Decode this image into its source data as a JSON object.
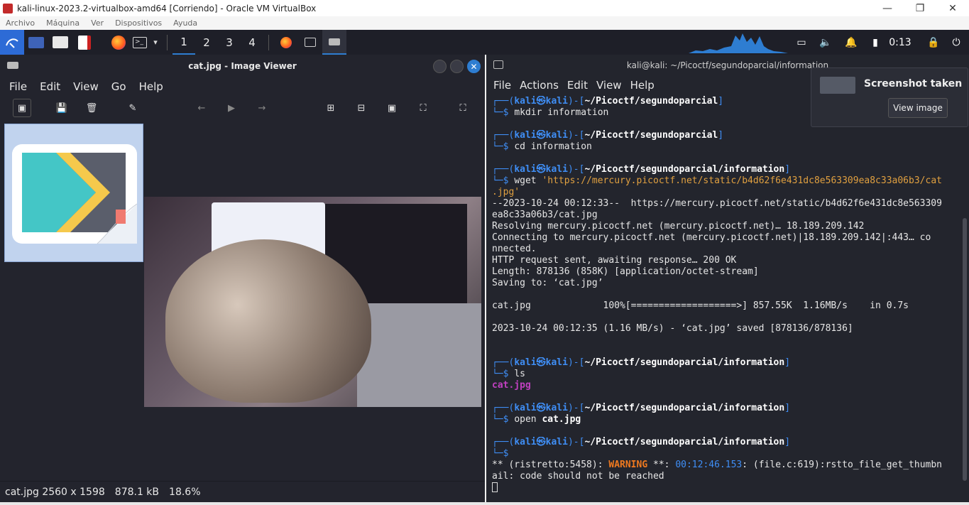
{
  "vbox": {
    "title": "kali-linux-2023.2-virtualbox-amd64 [Corriendo] - Oracle VM VirtualBox",
    "menu": [
      "Archivo",
      "Máquina",
      "Ver",
      "Dispositivos",
      "Ayuda"
    ],
    "controls": {
      "minimize": "—",
      "restore": "❐",
      "close": "✕"
    }
  },
  "panel": {
    "workspaces": [
      "1",
      "2",
      "3",
      "4"
    ],
    "clock": "0:13",
    "icons": [
      "kali-menu-icon",
      "desktop-icon",
      "files-icon",
      "text-editor-icon",
      "firefox-icon",
      "terminal-icon",
      "chevron-down-icon",
      "firefox-task-icon",
      "terminal-task-icon",
      "viewer-task-icon",
      "display-icon",
      "volume-icon",
      "bell-icon",
      "battery-icon",
      "lock-icon",
      "logout-icon"
    ]
  },
  "viewer": {
    "title": "cat.jpg - Image Viewer",
    "menu": [
      "File",
      "Edit",
      "View",
      "Go",
      "Help"
    ],
    "status": {
      "name_size": "cat.jpg 2560 x 1598",
      "filesize": "878.1 kB",
      "zoom": "18.6%"
    }
  },
  "terminal": {
    "title": "kali@kali: ~/Picoctf/segundoparcial/information",
    "menu": [
      "File",
      "Actions",
      "Edit",
      "View",
      "Help"
    ],
    "user": "kali",
    "host": "kali",
    "path1": "~/Picoctf/segundoparcial",
    "path2": "~/Picoctf/segundoparcial/information",
    "cmd1": "mkdir information",
    "cmd2": "cd information",
    "cmd3_wget": "wget",
    "cmd3_url": "'https://mercury.picoctf.net/static/b4d62f6e431dc8e563309ea8c33a06b3/cat",
    "cmd3_url2": ".jpg'",
    "out1": "--2023-10-24 00:12:33--  https://mercury.picoctf.net/static/b4d62f6e431dc8e563309",
    "out2": "ea8c33a06b3/cat.jpg",
    "out3": "Resolving mercury.picoctf.net (mercury.picoctf.net)… 18.189.209.142",
    "out4": "Connecting to mercury.picoctf.net (mercury.picoctf.net)|18.189.209.142|:443… co",
    "out5": "nnected.",
    "out6": "HTTP request sent, awaiting response… 200 OK",
    "out7": "Length: 878136 (858K) [application/octet-stream]",
    "out8": "Saving to: ‘cat.jpg’",
    "out9": "cat.jpg             100%[===================>] 857.55K  1.16MB/s    in 0.7s",
    "out10": "2023-10-24 00:12:35 (1.16 MB/s) - ‘cat.jpg’ saved [878136/878136]",
    "cmd4": "ls",
    "ls_out": "cat.jpg",
    "cmd5_open": "open",
    "cmd5_arg": "cat.jpg",
    "warn_pre": "** (ristretto:5458): ",
    "warn_word": "WARNING",
    "warn_mid": " **: ",
    "warn_time": "00:12:46.153",
    "warn_rest": ": (file.c:619):rstto_file_get_thumbn",
    "warn_rest2": "ail: code should not be reached"
  },
  "notification": {
    "title": "Screenshot taken",
    "button": "View image"
  }
}
